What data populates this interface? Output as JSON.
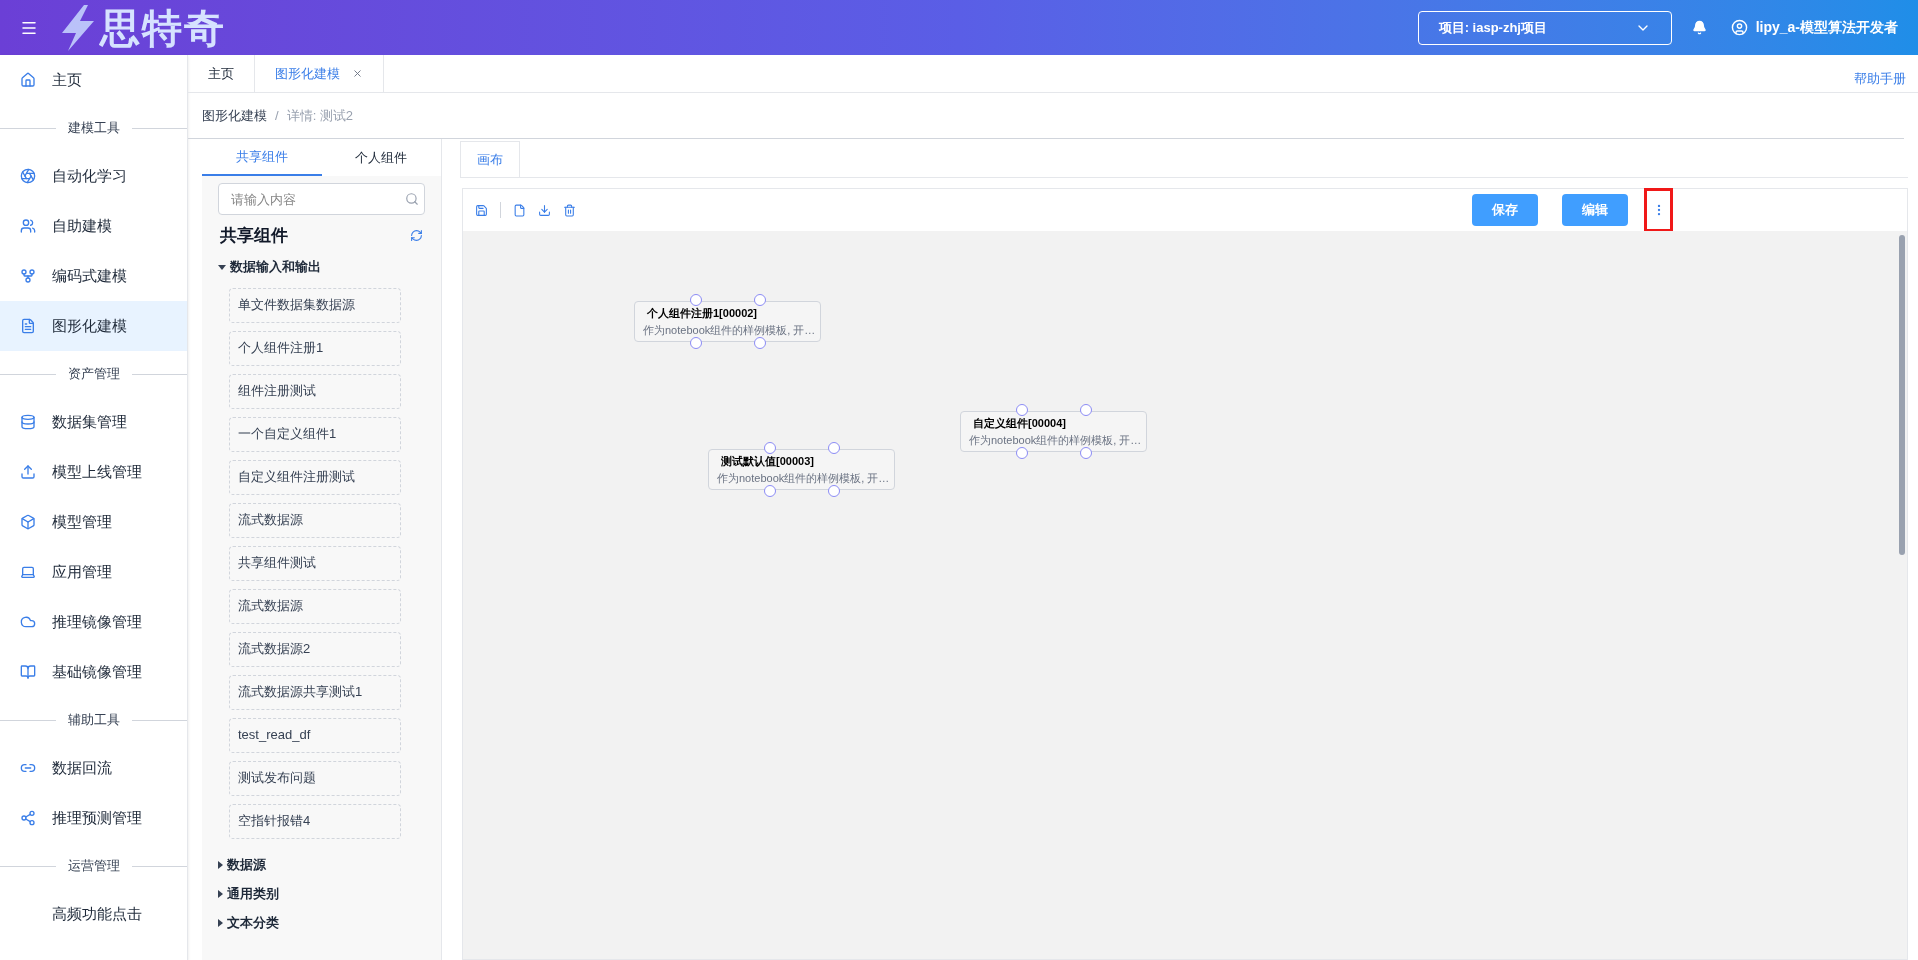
{
  "header": {
    "logo_text": "思特奇",
    "project": "项目: iasp-zhj项目",
    "user": "lipy_a-模型算法开发者"
  },
  "sidebar": {
    "groups": [
      {
        "items": [
          {
            "label": "主页",
            "selected": false
          }
        ]
      },
      {
        "title": "建模工具",
        "items": [
          {
            "label": "自动化学习",
            "selected": false
          },
          {
            "label": "自助建模",
            "selected": false
          },
          {
            "label": "编码式建模",
            "selected": false
          },
          {
            "label": "图形化建模",
            "selected": true
          }
        ]
      },
      {
        "title": "资产管理",
        "items": [
          {
            "label": "数据集管理",
            "selected": false
          },
          {
            "label": "模型上线管理",
            "selected": false
          },
          {
            "label": "模型管理",
            "selected": false
          },
          {
            "label": "应用管理",
            "selected": false
          },
          {
            "label": "推理镜像管理",
            "selected": false
          },
          {
            "label": "基础镜像管理",
            "selected": false
          }
        ]
      },
      {
        "title": "辅助工具",
        "items": [
          {
            "label": "数据回流",
            "selected": false
          },
          {
            "label": "推理预测管理",
            "selected": false
          }
        ]
      },
      {
        "title": "运营管理",
        "items": [
          {
            "label": "高频功能点击",
            "selected": false
          }
        ]
      }
    ]
  },
  "page_tabs": [
    {
      "label": "主页",
      "selected": false,
      "closable": false
    },
    {
      "label": "图形化建模",
      "selected": true,
      "closable": true
    }
  ],
  "help_link": "帮助手册",
  "breadcrumb": {
    "items": [
      "图形化建模",
      "详情: 测试2"
    ],
    "separator": "/"
  },
  "component_panel": {
    "tabs": [
      {
        "label": "共享组件",
        "selected": true
      },
      {
        "label": "个人组件",
        "selected": false
      }
    ],
    "search": {
      "placeholder": "请输入内容"
    },
    "title": "共享组件",
    "tree": [
      {
        "label": "数据输入和输出",
        "expanded": true,
        "children": [
          {
            "label": "单文件数据集数据源"
          },
          {
            "label": "个人组件注册1"
          },
          {
            "label": "组件注册测试"
          },
          {
            "label": "一个自定义组件1"
          },
          {
            "label": "自定义组件注册测试"
          },
          {
            "label": "流式数据源"
          },
          {
            "label": "共享组件测试"
          },
          {
            "label": "流式数据源"
          },
          {
            "label": "流式数据源2"
          },
          {
            "label": "流式数据源共享测试1"
          },
          {
            "label": "test_read_df"
          },
          {
            "label": "测试发布问题"
          },
          {
            "label": "空指针报错4"
          }
        ]
      },
      {
        "label": "数据源",
        "expanded": false
      },
      {
        "label": "通用类别",
        "expanded": false
      },
      {
        "label": "文本分类",
        "expanded": false
      }
    ]
  },
  "canvas": {
    "tabs": [
      {
        "label": "画布",
        "selected": true
      }
    ],
    "buttons": [
      "保存",
      "编辑"
    ],
    "more_highlighted": true,
    "nodes": [
      {
        "title": "个人组件注册1[00002]",
        "desc": "作为notebook组件的样例模板, 开…"
      },
      {
        "title": "测试默认值[00003]",
        "desc": "作为notebook组件的样例模板, 开…"
      },
      {
        "title": "自定义组件[00004]",
        "desc": "作为notebook组件的样例模板, 开…"
      }
    ]
  }
}
